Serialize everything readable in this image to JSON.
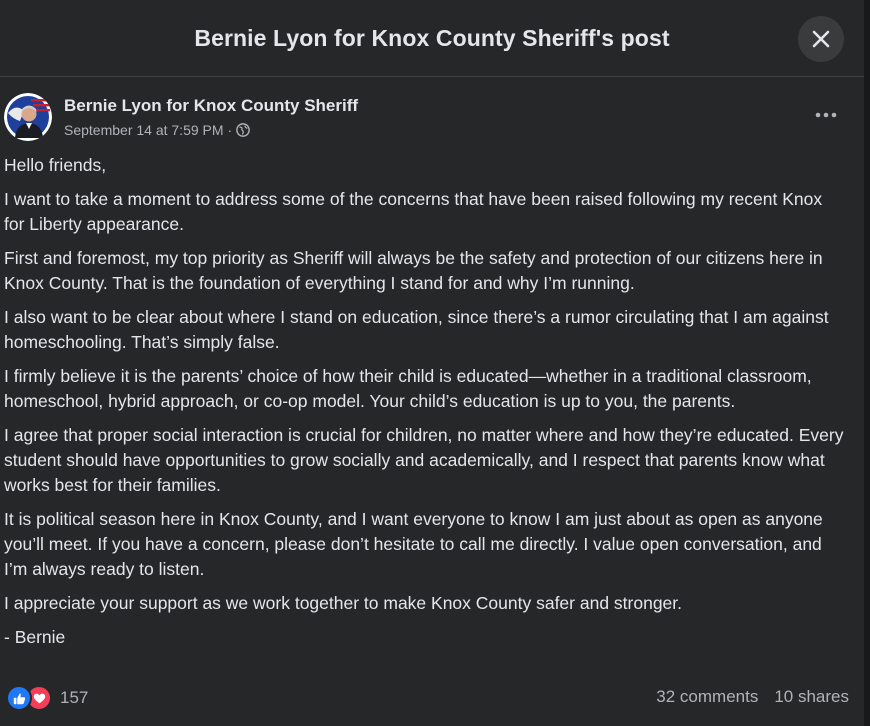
{
  "dialog": {
    "title": "Bernie Lyon for Knox County Sheriff's post"
  },
  "post": {
    "author": "Bernie Lyon for Knox County Sheriff",
    "timestamp": "September 14 at 7:59 PM",
    "separator": "·",
    "paragraphs": [
      "Hello friends,",
      "I want to take a moment to address some of the concerns that have been raised following my recent Knox for Liberty appearance.",
      "First and foremost, my top priority as Sheriff will always be the safety and protection of our citizens here in Knox County. That is the foundation of everything I stand for and why I’m running.",
      "I also want to be clear about where I stand on education, since there’s a rumor circulating that I am against homeschooling. That’s simply false.",
      "I firmly believe it is the parents’ choice of how their child is educated—whether in a traditional classroom, homeschool, hybrid approach, or co-op model. Your child’s education is up to you, the parents.",
      "I agree that proper social interaction is crucial for children, no matter where and how they’re educated. Every student should have opportunities to grow socially and academically, and I respect that parents know what works best for their families.",
      "It is political season here in Knox County, and I want everyone to know I am just about as open as anyone you’ll meet. If you have a concern, please don’t hesitate to call me directly. I value open conversation, and I’m always ready to listen.",
      "I appreciate your support as we work together to make Knox County safer and stronger.",
      "- Bernie"
    ]
  },
  "footer": {
    "reaction_count": "157",
    "comments": "32 comments",
    "shares": "10 shares"
  },
  "icons": {
    "close": "close-icon",
    "more": "more-options-icon",
    "audience": "globe-icon",
    "like": "like-reaction-icon",
    "love": "love-reaction-icon"
  },
  "colors": {
    "background": "#252728",
    "text": "#e4e6eb",
    "secondary_text": "#b0b3b8",
    "like_blue": "#2078f4",
    "love_red": "#f33e58"
  }
}
